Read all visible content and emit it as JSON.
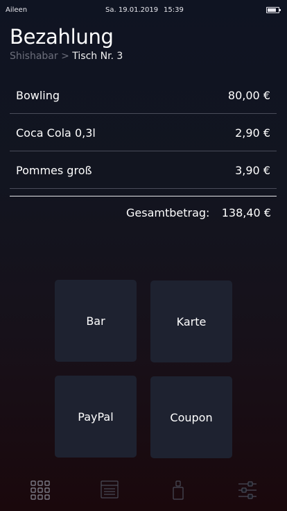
{
  "status_bar": {
    "carrier": "Aileen",
    "date": "Sa. 19.01.2019",
    "time": "15:39",
    "battery_level": 0.8
  },
  "header": {
    "title": "Bezahlung",
    "breadcrumb": {
      "parent": "Shishabar",
      "separator": ">",
      "current": "Tisch Nr. 3"
    }
  },
  "items": [
    {
      "name": "Bowling",
      "price": "80,00 €"
    },
    {
      "name": "Coca Cola 0,3l",
      "price": "2,90 €"
    },
    {
      "name": "Pommes groß",
      "price": "3,90 €"
    }
  ],
  "total": {
    "label": "Gesamtbetrag:",
    "value": "138,40 €"
  },
  "payment_methods": {
    "bar": "Bar",
    "karte": "Karte",
    "paypal": "PayPal",
    "coupon": "Coupon"
  },
  "tab_bar": {
    "icons": [
      "grid-icon",
      "list-icon",
      "device-icon",
      "sliders-icon"
    ],
    "active_color": "#8a8c99",
    "inactive_color": "#4a4c58"
  },
  "colors": {
    "background_top": "#0f1422",
    "background_bottom": "#1a080c",
    "button_bg": "#1e2230",
    "divider": "#4a4c5a",
    "breadcrumb_muted": "#6d6f7c"
  }
}
